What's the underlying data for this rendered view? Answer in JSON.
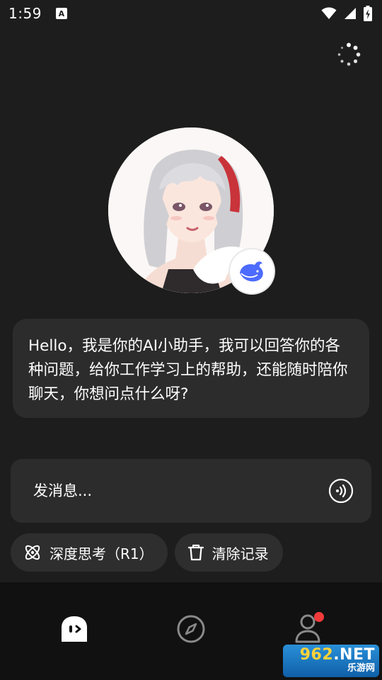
{
  "status_bar": {
    "time": "1:59",
    "notification_icon": "a-letter-icon",
    "wifi_icon": "wifi-icon",
    "signal_icon": "cell-signal-icon",
    "battery_icon": "battery-charging-icon"
  },
  "header": {
    "loader_icon": "loading-spinner-icon"
  },
  "assistant": {
    "avatar": "anime-girl-avatar",
    "badge_icon": "whale-logo-icon",
    "greeting": "Hello，我是你的AI小助手，我可以回答你的各种问题，给你工作学习上的帮助，还能随时陪你聊天，你想问点什么呀?"
  },
  "composer": {
    "placeholder": "发消息...",
    "value": "",
    "voice_icon": "voice-wave-icon"
  },
  "actions": {
    "deep_think_label": "深度思考（R1）",
    "deep_think_icon": "atom-icon",
    "clear_label": "清除记录",
    "clear_icon": "trash-icon"
  },
  "bottom_nav": {
    "items": [
      {
        "name": "chat",
        "icon": "chat-face-icon",
        "active": true
      },
      {
        "name": "discover",
        "icon": "compass-icon",
        "active": false
      },
      {
        "name": "profile",
        "icon": "person-icon",
        "active": false,
        "badge": true
      }
    ]
  },
  "watermark": {
    "top": "962",
    "top_suffix": ".NET",
    "bottom": "乐游网"
  },
  "colors": {
    "background": "#1d1d1d",
    "card": "#2c2c2c",
    "nav_background": "#111111",
    "badge_red": "#f23a3a",
    "brand_blue": "#4d6bfe"
  }
}
